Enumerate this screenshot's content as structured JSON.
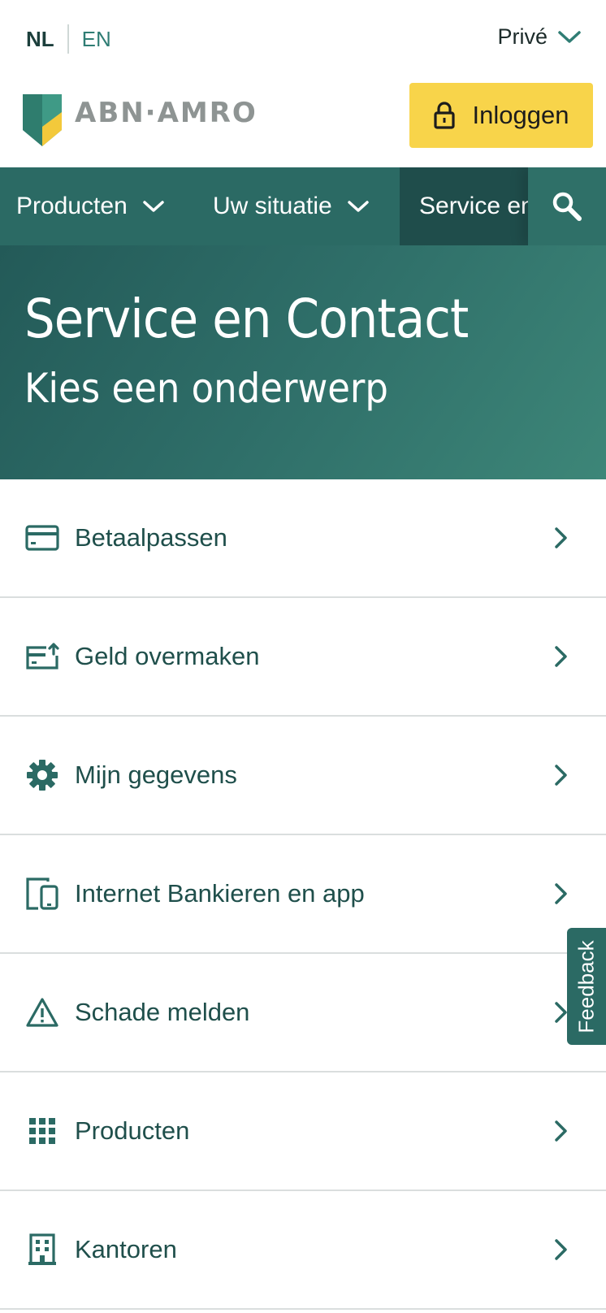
{
  "topbar": {
    "lang_nl": "NL",
    "lang_en": "EN",
    "segment": "Privé"
  },
  "header": {
    "brand": "ABN·AMRO",
    "login_label": "Inloggen"
  },
  "nav": {
    "items": [
      {
        "label": "Producten"
      },
      {
        "label": "Uw situatie"
      },
      {
        "label": "Service en Contact"
      }
    ]
  },
  "hero": {
    "title": "Service en Contact",
    "subtitle": "Kies een onderwerp"
  },
  "topics": [
    {
      "label": "Betaalpassen",
      "icon": "card-icon"
    },
    {
      "label": "Geld overmaken",
      "icon": "transfer-icon"
    },
    {
      "label": "Mijn gegevens",
      "icon": "gear-icon"
    },
    {
      "label": "Internet Bankieren en app",
      "icon": "devices-icon"
    },
    {
      "label": "Schade melden",
      "icon": "warning-icon"
    },
    {
      "label": "Producten",
      "icon": "grid-icon"
    },
    {
      "label": "Kantoren",
      "icon": "building-icon"
    }
  ],
  "feedback_label": "Feedback",
  "colors": {
    "brand_green": "#2b6a64",
    "brand_yellow": "#f8d44a",
    "text_dark_green": "#1f4f4b",
    "logo_gray": "#8e9493"
  }
}
